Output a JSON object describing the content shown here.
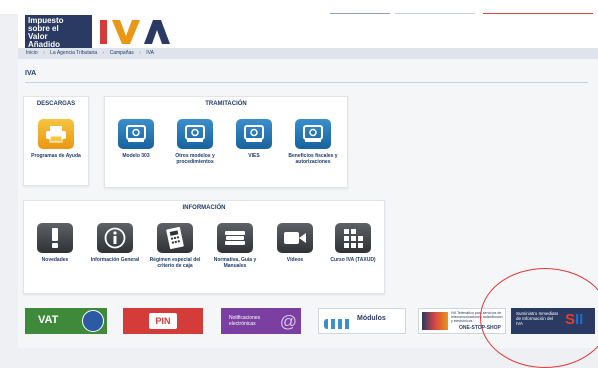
{
  "header": {
    "logo_lines": [
      "Impuesto",
      "sobre el",
      "Valor",
      "Añadido"
    ],
    "iva_logo_text": "IVA"
  },
  "breadcrumb": [
    "Inicio",
    "La Agencia Tributaria",
    "Campañas",
    "IVA"
  ],
  "page_title": "IVA",
  "descargas": {
    "title": "DESCARGAS",
    "items": [
      {
        "label": "Programas de Ayuda",
        "icon": "printer-icon"
      }
    ]
  },
  "tramitacion": {
    "title": "TRAMITACIÓN",
    "items": [
      {
        "label": "Modelo 303",
        "icon": "form-icon"
      },
      {
        "label": "Otros modelos y procedimientos",
        "icon": "form-icon"
      },
      {
        "label": "VIES",
        "icon": "form-icon"
      },
      {
        "label": "Beneficios fiscales y autorizaciones",
        "icon": "form-icon"
      }
    ]
  },
  "informacion": {
    "title": "INFORMACIÓN",
    "items": [
      {
        "label": "Novedades",
        "icon": "exclamation-icon"
      },
      {
        "label": "Información General",
        "icon": "info-icon"
      },
      {
        "label": "Régimen especial del criterio de caja",
        "icon": "calculator-icon"
      },
      {
        "label": "Normativa, Guía y Manuales",
        "icon": "books-icon"
      },
      {
        "label": "Vídeos",
        "icon": "video-camera-icon"
      },
      {
        "label": "Curso IVA (TAXUD)",
        "icon": "course-icon"
      }
    ]
  },
  "banners": {
    "vat": "VAT",
    "pin": "PIN",
    "notificaciones": [
      "Notificaciones",
      "electrónicas"
    ],
    "modulos": "Módulos",
    "oss_top": "IVA Telemático para servicios de telecomunicaciones radiodifusión y electrónicos",
    "oss_bottom": "ONE-STOP-SHOP",
    "sii_text": "Suministro Inmediato de Información del IVA",
    "sii_brand_s": "S",
    "sii_brand_ii": "II"
  },
  "colors": {
    "brand_navy": "#2b3a62",
    "tile_blue": "#17629f",
    "tile_dark": "#2f3235",
    "tile_orange": "#e99714",
    "highlight_red": "#e03a3a"
  }
}
